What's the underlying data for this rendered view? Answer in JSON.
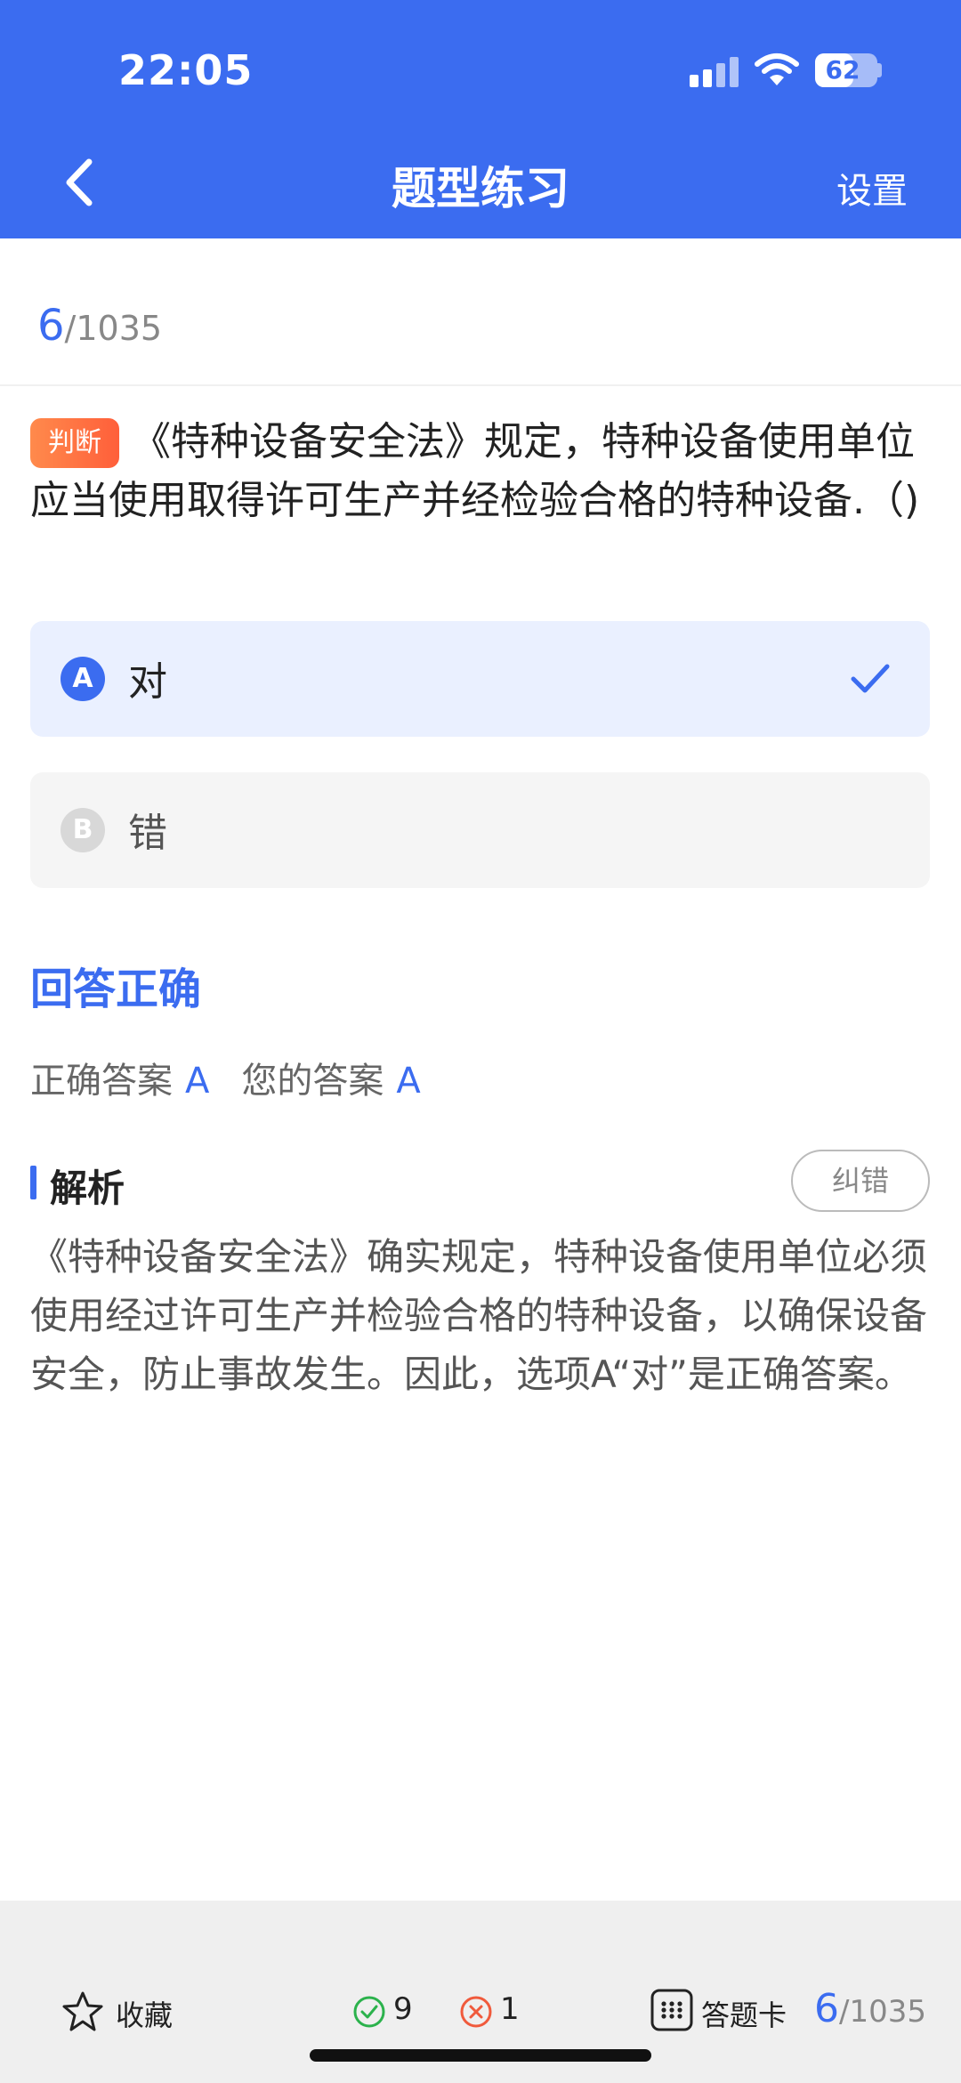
{
  "status_bar": {
    "time": "22:05",
    "battery": "62",
    "battery_level": 0.62
  },
  "nav": {
    "title": "题型练习",
    "settings": "设置"
  },
  "progress": {
    "current": "6",
    "total": "/1035"
  },
  "question": {
    "type": "判断",
    "text": "《特种设备安全法》规定，特种设备使用单位应当使用取得许可生产并经检验合格的特种设备.（)"
  },
  "options": [
    {
      "letter": "A",
      "text": "对",
      "selected": true
    },
    {
      "letter": "B",
      "text": "错",
      "selected": false
    }
  ],
  "result": {
    "title": "回答正确",
    "correct_label": "正确答案",
    "correct_answer": "A",
    "your_label": "您的答案",
    "your_answer": "A"
  },
  "analysis": {
    "title": "解析",
    "report_button": "纠错",
    "text": "《特种设备安全法》确实规定，特种设备使用单位必须使用经过许可生产并检验合格的特种设备，以确保设备安全，防止事故发生。因此，选项A“对”是正确答案。"
  },
  "bottom_bar": {
    "favorite": "收藏",
    "correct_count": "9",
    "wrong_count": "1",
    "answer_card": "答题卡",
    "progress_current": "6",
    "progress_total": "/1035"
  },
  "colors": {
    "primary": "#3b6cf0",
    "badge": "#ff6a3d",
    "correct": "#2bb24c",
    "wrong": "#f05a3c"
  },
  "icons": [
    "back-arrow-icon",
    "signal-icon",
    "wifi-icon",
    "battery-icon",
    "check-icon",
    "star-icon",
    "check-circle-icon",
    "x-circle-icon",
    "grid-icon"
  ]
}
